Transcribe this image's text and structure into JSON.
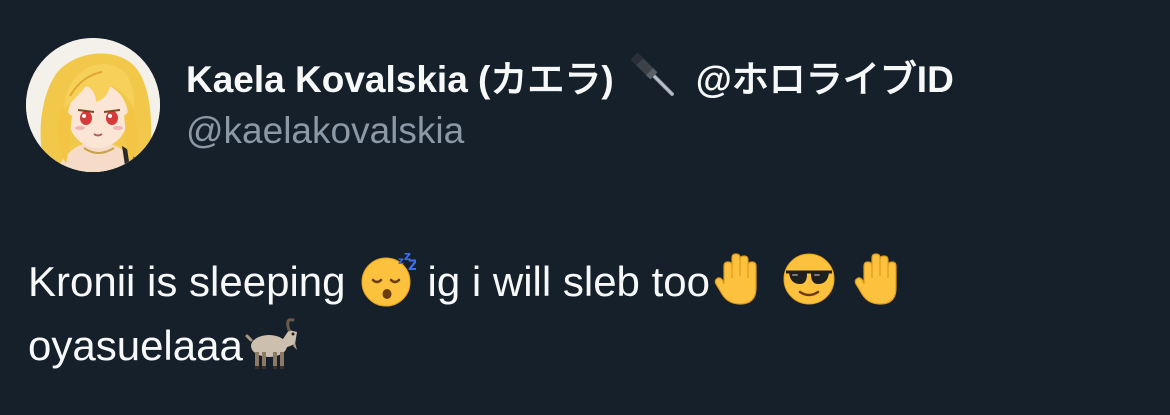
{
  "author": {
    "display_name": "Kaela Kovalskia (カエラ)",
    "name_suffix": "@ホロライブID",
    "handle": "@kaelakovalskia",
    "name_emoji": "hammer-icon",
    "avatar": "profile-avatar"
  },
  "tweet": {
    "line1_part1": "Kronii is sleeping",
    "line1_part2": "ig i will sleb too",
    "line2_text": "oyasuelaaa",
    "emojis": [
      "sleeping-face-icon",
      "raised-hand-icon",
      "sunglasses-face-icon",
      "raised-hand-icon",
      "goat-icon"
    ]
  },
  "colors": {
    "background": "#15202b",
    "text": "#f7f9f9",
    "secondary_text": "#8b98a5"
  }
}
